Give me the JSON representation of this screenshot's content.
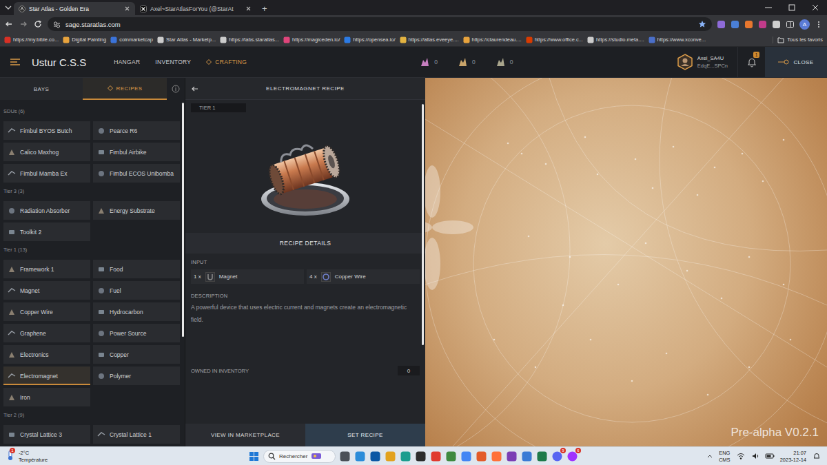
{
  "browser": {
    "tabs": [
      {
        "label": "Star Atlas - Golden Era",
        "selected": true
      },
      {
        "label": "Axel~StarAtlasForYou (@StarAt",
        "selected": false
      }
    ],
    "new_tab": "+",
    "url": "sage.staratlas.com",
    "profile": "A",
    "bookmarks": [
      "https://my.bible.co...",
      "Digital Painting",
      "coinmarketcap",
      "Star Atlas - Marketp...",
      "https://labs.staratlas...",
      "https://magiceden.io/",
      "https://opensea.io/",
      "https://atlas.eveeye....",
      "https://claurendeau....",
      "https://www.office.c...",
      "https://studio.meta....",
      "https://www.xconve..."
    ],
    "all_bookmarks": "Tous les favoris"
  },
  "app": {
    "station": "Ustur C.S.S",
    "nav": [
      {
        "label": "HANGAR",
        "selected": false
      },
      {
        "label": "INVENTORY",
        "selected": false
      },
      {
        "label": "CRAFTING",
        "selected": true
      }
    ],
    "resources": [
      {
        "count": "0",
        "color": "#c77fc0"
      },
      {
        "count": "0",
        "color": "#c9a46a"
      },
      {
        "count": "0",
        "color": "#a9a58c"
      }
    ],
    "user": {
      "name": "Axel_SA4U",
      "wallet": "EdqE...SPCn"
    },
    "notifications": "1",
    "close": "CLOSE"
  },
  "sidebar": {
    "tabs": [
      {
        "label": "BAYS",
        "selected": false
      },
      {
        "label": "RECIPES",
        "selected": true
      }
    ],
    "sections": [
      {
        "title": "SDUs (6)",
        "items": [
          {
            "label": "Fimbul BYOS Butch",
            "selected": false
          },
          {
            "label": "Pearce R6",
            "selected": false
          },
          {
            "label": "Calico Maxhog",
            "selected": false
          },
          {
            "label": "Fimbul Airbike",
            "selected": false
          },
          {
            "label": "Fimbul Mamba Ex",
            "selected": false
          },
          {
            "label": "Fimbul ECOS Unibomba",
            "selected": false
          }
        ]
      },
      {
        "title": "Tier 3 (3)",
        "items": [
          {
            "label": "Radiation Absorber",
            "selected": false
          },
          {
            "label": "Energy Substrate",
            "selected": false
          },
          {
            "label": "Toolkit 2",
            "selected": false
          }
        ]
      },
      {
        "title": "Tier 1 (13)",
        "items": [
          {
            "label": "Framework 1",
            "selected": false
          },
          {
            "label": "Food",
            "selected": false
          },
          {
            "label": "Magnet",
            "selected": false
          },
          {
            "label": "Fuel",
            "selected": false
          },
          {
            "label": "Copper Wire",
            "selected": false
          },
          {
            "label": "Hydrocarbon",
            "selected": false
          },
          {
            "label": "Graphene",
            "selected": false
          },
          {
            "label": "Power Source",
            "selected": false
          },
          {
            "label": "Electronics",
            "selected": false
          },
          {
            "label": "Copper",
            "selected": false
          },
          {
            "label": "Electromagnet",
            "selected": true
          },
          {
            "label": "Polymer",
            "selected": false
          },
          {
            "label": "Iron",
            "selected": false
          }
        ]
      },
      {
        "title": "Tier 2 (9)",
        "items": [
          {
            "label": "Crystal Lattice 3",
            "selected": false
          },
          {
            "label": "Crystal Lattice 1",
            "selected": false
          }
        ]
      }
    ]
  },
  "recipe": {
    "title": "ELECTROMAGNET RECIPE",
    "tier": "TIER 1",
    "details_heading": "RECIPE DETAILS",
    "input_label": "INPUT",
    "inputs": [
      {
        "qty": "1 x",
        "name": "Magnet"
      },
      {
        "qty": "4 x",
        "name": "Copper Wire"
      }
    ],
    "description_label": "DESCRIPTION",
    "description": "A powerful device that uses electric current and magnets create an electromagnetic field.",
    "owned_label": "OWNED IN INVENTORY",
    "owned": "0",
    "buttons": [
      {
        "label": "VIEW IN MARKETPLACE",
        "primary": false
      },
      {
        "label": "SET RECIPE",
        "primary": true
      }
    ]
  },
  "version": "Pre-alpha V0.2.1",
  "taskbar": {
    "weather": {
      "temp": "-2°C",
      "label": "Température",
      "badge": "1"
    },
    "search": "Rechercher",
    "app_badges": [
      {
        "badge": "9"
      },
      {
        "badge": "6"
      }
    ],
    "language": "ENG",
    "layout": "CMS",
    "time": "21:07",
    "date": "2023-12-14"
  }
}
